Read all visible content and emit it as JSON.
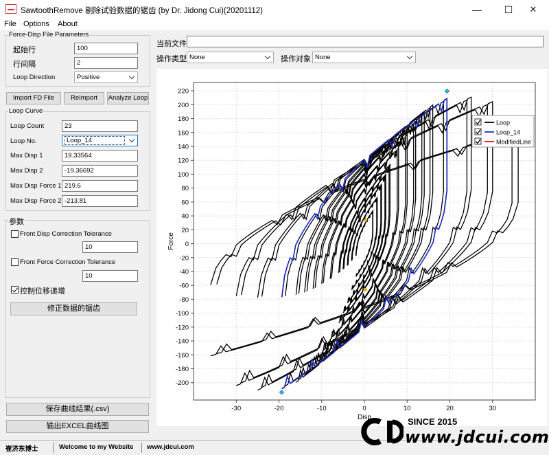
{
  "window": {
    "title": "SawtoothRemove 剔除试验数据的锯齿 (by Dr. Jidong Cui)(20201112)",
    "minimize_glyph": "—",
    "maximize_glyph": "☐",
    "close_glyph": "✕"
  },
  "menu": [
    "File",
    "Options",
    "About"
  ],
  "file_params": {
    "title": "Force-Disp File Parameters",
    "start_row_label": "起始行",
    "start_row_value": "100",
    "row_interval_label": "行间隔",
    "row_interval_value": "2",
    "loop_direction_label": "Loop Direction",
    "loop_direction_value": "Positive"
  },
  "buttons": {
    "import": "Import FD File",
    "reimport": "ReImport",
    "analyze": "Analyze Loop",
    "correct": "修正数据的锯齿",
    "save": "保存曲线结果(.csv)",
    "export": "输出EXCEL曲线图"
  },
  "loop_curve": {
    "title": "Loop Curve",
    "loop_count_label": "Loop Count",
    "loop_count_value": "23",
    "loop_no_label": "Loop No.",
    "loop_no_value": "Loop_14",
    "max_disp1_label": "Max Disp 1",
    "max_disp1_value": "19.33564",
    "max_disp2_label": "Max Disp 2",
    "max_disp2_value": "-19.36692",
    "max_force1_label": "Max Disp Force 1",
    "max_force1_value": "219.6",
    "max_force2_label": "Max Disp Force 2",
    "max_force2_value": "-213.81"
  },
  "params": {
    "title": "参数",
    "front_disp_label": "Front Disp Correction Tolerance",
    "front_disp_checked": false,
    "front_disp_value": "10",
    "front_force_label": "Front Force Correction Tolerance",
    "front_force_checked": false,
    "front_force_value": "10",
    "control_disp_label": "控制位移递增",
    "control_disp_checked": true
  },
  "top": {
    "current_file_label": "当前文件",
    "current_file_value": "",
    "op_type_label": "操作类型",
    "op_type_value": "None",
    "op_target_label": "操作对象",
    "op_target_value": "None"
  },
  "status": {
    "author": "崔济东博士",
    "welcome": "Welcome to my Website",
    "site": "www.jdcui.com"
  },
  "watermark": {
    "since": "SINCE 2015",
    "url": "www.jdcui.com"
  },
  "chart_data": {
    "type": "line",
    "xlabel": "Disp",
    "ylabel": "Force",
    "xlim": [
      -40,
      40
    ],
    "ylim": [
      -225,
      232
    ],
    "xticks": [
      -30,
      -20,
      -10,
      0,
      10,
      20,
      30
    ],
    "yticks": [
      -200,
      -180,
      -160,
      -140,
      -120,
      -100,
      -80,
      -60,
      -40,
      -20,
      0,
      20,
      40,
      60,
      80,
      100,
      120,
      140,
      160,
      180,
      200,
      220
    ],
    "grid": true,
    "legend_position": "top-right",
    "series": [
      {
        "name": "Loop",
        "color": "#000000",
        "checked": true
      },
      {
        "name": "Loop_14",
        "color": "#1f2fd8",
        "checked": true
      },
      {
        "name": "ModifiedLine",
        "color": "#e01010",
        "checked": true
      }
    ],
    "loops_amplitudes": [
      {
        "d": 2,
        "f": 50
      },
      {
        "d": 3,
        "f": 70
      },
      {
        "d": 4,
        "f": 90
      },
      {
        "d": 5,
        "f": 105
      },
      {
        "d": 6,
        "f": 120
      },
      {
        "d": 8,
        "f": 145
      },
      {
        "d": 10,
        "f": 165
      },
      {
        "d": 12,
        "f": 185
      },
      {
        "d": 14,
        "f": 200
      },
      {
        "d": 16,
        "f": 210
      },
      {
        "d": 19.3,
        "f": 220
      },
      {
        "d": 25,
        "f": 222
      },
      {
        "d": 30,
        "f": 215
      },
      {
        "d": 36,
        "f": 170
      }
    ],
    "loop14": {
      "max_disp1": 19.33564,
      "max_force1": 219.6,
      "max_disp2": -19.36692,
      "max_force2": -213.81
    },
    "markers": [
      {
        "x": 0.3,
        "y": 34,
        "color": "#d8b800"
      },
      {
        "x": 0.2,
        "y": -66,
        "color": "#d8b800"
      }
    ]
  }
}
